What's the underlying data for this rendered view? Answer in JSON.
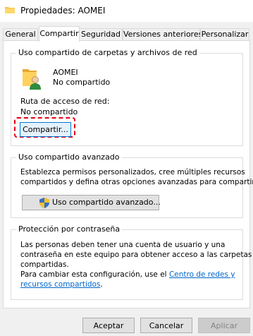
{
  "window": {
    "title": "Propiedades: AOMEI"
  },
  "tabs": [
    {
      "label": "General"
    },
    {
      "label": "Compartir"
    },
    {
      "label": "Seguridad"
    },
    {
      "label": "Versiones anteriores"
    },
    {
      "label": "Personalizar"
    }
  ],
  "network_sharing": {
    "title": "Uso compartido de carpetas y archivos de red",
    "folder_name": "AOMEI",
    "folder_status": "No compartido",
    "path_label": "Ruta de acceso de red:",
    "path_value": "No compartido",
    "share_button": "Compartir..."
  },
  "advanced_sharing": {
    "title": "Uso compartido avanzado",
    "description_line1": "Establezca permisos personalizados, cree múltiples recursos",
    "description_line2": "compartidos y defina otras opciones avanzadas para compartir.",
    "button": "Uso compartido avanzado..."
  },
  "password_protection": {
    "title": "Protección por contraseña",
    "line1": "Las personas deben tener una cuenta de usuario y una",
    "line2": "contraseña en este equipo para obtener acceso a las carpetas",
    "line3": "compartidas.",
    "line4_prefix": "Para cambiar esta configuración, use el ",
    "link_part1": "Centro de redes y",
    "link_part2": "recursos compartidos",
    "line5_suffix": "."
  },
  "footer": {
    "accept": "Aceptar",
    "cancel": "Cancelar",
    "apply": "Aplicar"
  },
  "colors": {
    "highlight": "#e60012",
    "link": "#0066cc",
    "focus": "#0078d7"
  }
}
